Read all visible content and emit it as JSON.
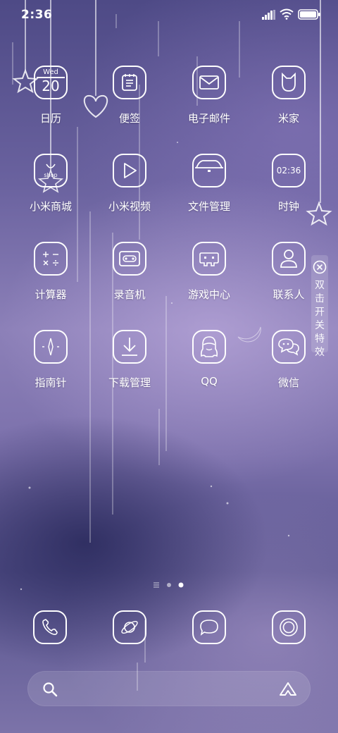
{
  "status_bar": {
    "time": "2:36",
    "icons": [
      "signal-icon",
      "wifi-icon",
      "battery-icon"
    ]
  },
  "apps": [
    {
      "label": "日历",
      "icon": "calendar-icon",
      "calendar_day": "Wed",
      "calendar_date": "20"
    },
    {
      "label": "便签",
      "icon": "notes-icon"
    },
    {
      "label": "电子邮件",
      "icon": "mail-icon"
    },
    {
      "label": "米家",
      "icon": "mijia-icon"
    },
    {
      "label": "小米商城",
      "icon": "mi-store-icon",
      "icon_text": "shop"
    },
    {
      "label": "小米视频",
      "icon": "video-play-icon"
    },
    {
      "label": "文件管理",
      "icon": "folder-icon"
    },
    {
      "label": "时钟",
      "icon": "clock-icon",
      "icon_text": "02:36"
    },
    {
      "label": "计算器",
      "icon": "calculator-icon"
    },
    {
      "label": "录音机",
      "icon": "recorder-icon"
    },
    {
      "label": "游戏中心",
      "icon": "gamepad-icon"
    },
    {
      "label": "联系人",
      "icon": "contacts-icon"
    },
    {
      "label": "指南针",
      "icon": "compass-icon"
    },
    {
      "label": "下载管理",
      "icon": "download-icon"
    },
    {
      "label": "QQ",
      "icon": "qq-icon"
    },
    {
      "label": "微信",
      "icon": "wechat-icon"
    }
  ],
  "effect_toggle": {
    "text": "双击开关特效",
    "icon": "close-circle-icon"
  },
  "page_indicator": {
    "pages": 3,
    "current": 3
  },
  "dock": [
    {
      "icon": "phone-icon"
    },
    {
      "icon": "browser-planet-icon"
    },
    {
      "icon": "messages-icon"
    },
    {
      "icon": "camera-icon"
    }
  ],
  "search": {
    "icons": [
      "search-icon",
      "assistant-icon"
    ]
  },
  "colors": {
    "foreground": "#ffffff",
    "wallpaper_top": "#4e4a86",
    "wallpaper_mid": "#8c80b8"
  }
}
